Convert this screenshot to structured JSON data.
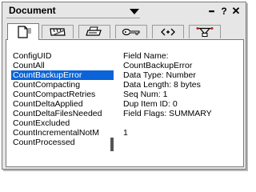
{
  "window": {
    "title": "Document",
    "controls": [
      "▪▪▪",
      "?",
      "✕"
    ]
  },
  "tabs": [
    {
      "icon": "document-icon",
      "active": true
    },
    {
      "icon": "ruler-icon",
      "active": false
    },
    {
      "icon": "printer-icon",
      "active": false
    },
    {
      "icon": "key-icon",
      "active": false
    },
    {
      "icon": "html-tags-icon",
      "active": false
    },
    {
      "icon": "fields-icon",
      "active": false
    }
  ],
  "fields_list": {
    "items": [
      "ConfigUID",
      "CountAll",
      "CountBackupError",
      "CountCompacting",
      "CountCompactRetries",
      "CountDeltaApplied",
      "CountDeltaFilesNeeded",
      "CountExcluded",
      "CountIncrementalNotM",
      "CountProcessed"
    ],
    "selected_index": 2
  },
  "field_details": {
    "field_name_label": "Field Name:",
    "field_name_value": "CountBackupError",
    "data_type": "Data Type: Number",
    "data_length": "Data Length: 8 bytes",
    "seq_num": "Seq Num: 1",
    "dup_item_id": "Dup Item ID: 0",
    "field_flags": "Field Flags: SUMMARY",
    "value": "1"
  }
}
